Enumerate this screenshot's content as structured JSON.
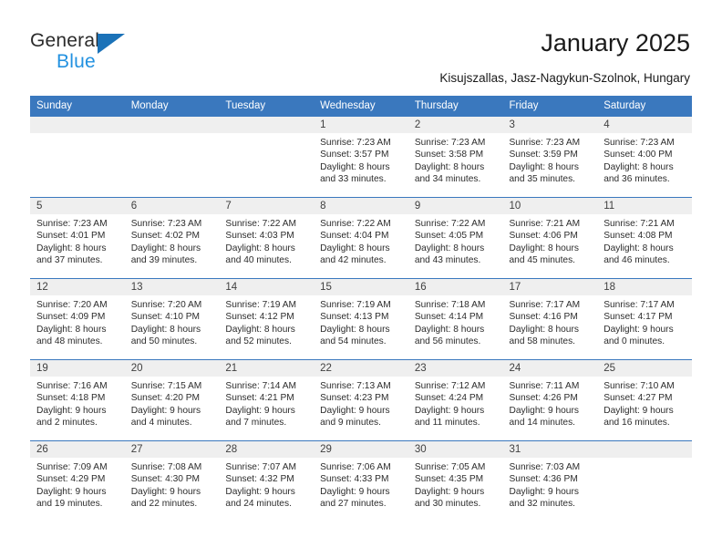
{
  "brand": {
    "name_top": "General",
    "name_bottom": "Blue",
    "accent_color": "#1b72b8",
    "accent_color_light": "#2291e0"
  },
  "header": {
    "title": "January 2025",
    "subtitle": "Kisujszallas, Jasz-Nagykun-Szolnok, Hungary"
  },
  "theme": {
    "header_row_bg": "#3a78be",
    "header_row_text": "#ffffff",
    "daynum_bg": "#efefef",
    "cell_bg": "#ffffff"
  },
  "calendar": {
    "weekday_headers": [
      "Sunday",
      "Monday",
      "Tuesday",
      "Wednesday",
      "Thursday",
      "Friday",
      "Saturday"
    ],
    "weeks": [
      [
        {
          "day": "",
          "empty": true
        },
        {
          "day": "",
          "empty": true
        },
        {
          "day": "",
          "empty": true
        },
        {
          "day": "1",
          "sunrise": "Sunrise: 7:23 AM",
          "sunset": "Sunset: 3:57 PM",
          "daylight1": "Daylight: 8 hours",
          "daylight2": "and 33 minutes."
        },
        {
          "day": "2",
          "sunrise": "Sunrise: 7:23 AM",
          "sunset": "Sunset: 3:58 PM",
          "daylight1": "Daylight: 8 hours",
          "daylight2": "and 34 minutes."
        },
        {
          "day": "3",
          "sunrise": "Sunrise: 7:23 AM",
          "sunset": "Sunset: 3:59 PM",
          "daylight1": "Daylight: 8 hours",
          "daylight2": "and 35 minutes."
        },
        {
          "day": "4",
          "sunrise": "Sunrise: 7:23 AM",
          "sunset": "Sunset: 4:00 PM",
          "daylight1": "Daylight: 8 hours",
          "daylight2": "and 36 minutes."
        }
      ],
      [
        {
          "day": "5",
          "sunrise": "Sunrise: 7:23 AM",
          "sunset": "Sunset: 4:01 PM",
          "daylight1": "Daylight: 8 hours",
          "daylight2": "and 37 minutes."
        },
        {
          "day": "6",
          "sunrise": "Sunrise: 7:23 AM",
          "sunset": "Sunset: 4:02 PM",
          "daylight1": "Daylight: 8 hours",
          "daylight2": "and 39 minutes."
        },
        {
          "day": "7",
          "sunrise": "Sunrise: 7:22 AM",
          "sunset": "Sunset: 4:03 PM",
          "daylight1": "Daylight: 8 hours",
          "daylight2": "and 40 minutes."
        },
        {
          "day": "8",
          "sunrise": "Sunrise: 7:22 AM",
          "sunset": "Sunset: 4:04 PM",
          "daylight1": "Daylight: 8 hours",
          "daylight2": "and 42 minutes."
        },
        {
          "day": "9",
          "sunrise": "Sunrise: 7:22 AM",
          "sunset": "Sunset: 4:05 PM",
          "daylight1": "Daylight: 8 hours",
          "daylight2": "and 43 minutes."
        },
        {
          "day": "10",
          "sunrise": "Sunrise: 7:21 AM",
          "sunset": "Sunset: 4:06 PM",
          "daylight1": "Daylight: 8 hours",
          "daylight2": "and 45 minutes."
        },
        {
          "day": "11",
          "sunrise": "Sunrise: 7:21 AM",
          "sunset": "Sunset: 4:08 PM",
          "daylight1": "Daylight: 8 hours",
          "daylight2": "and 46 minutes."
        }
      ],
      [
        {
          "day": "12",
          "sunrise": "Sunrise: 7:20 AM",
          "sunset": "Sunset: 4:09 PM",
          "daylight1": "Daylight: 8 hours",
          "daylight2": "and 48 minutes."
        },
        {
          "day": "13",
          "sunrise": "Sunrise: 7:20 AM",
          "sunset": "Sunset: 4:10 PM",
          "daylight1": "Daylight: 8 hours",
          "daylight2": "and 50 minutes."
        },
        {
          "day": "14",
          "sunrise": "Sunrise: 7:19 AM",
          "sunset": "Sunset: 4:12 PM",
          "daylight1": "Daylight: 8 hours",
          "daylight2": "and 52 minutes."
        },
        {
          "day": "15",
          "sunrise": "Sunrise: 7:19 AM",
          "sunset": "Sunset: 4:13 PM",
          "daylight1": "Daylight: 8 hours",
          "daylight2": "and 54 minutes."
        },
        {
          "day": "16",
          "sunrise": "Sunrise: 7:18 AM",
          "sunset": "Sunset: 4:14 PM",
          "daylight1": "Daylight: 8 hours",
          "daylight2": "and 56 minutes."
        },
        {
          "day": "17",
          "sunrise": "Sunrise: 7:17 AM",
          "sunset": "Sunset: 4:16 PM",
          "daylight1": "Daylight: 8 hours",
          "daylight2": "and 58 minutes."
        },
        {
          "day": "18",
          "sunrise": "Sunrise: 7:17 AM",
          "sunset": "Sunset: 4:17 PM",
          "daylight1": "Daylight: 9 hours",
          "daylight2": "and 0 minutes."
        }
      ],
      [
        {
          "day": "19",
          "sunrise": "Sunrise: 7:16 AM",
          "sunset": "Sunset: 4:18 PM",
          "daylight1": "Daylight: 9 hours",
          "daylight2": "and 2 minutes."
        },
        {
          "day": "20",
          "sunrise": "Sunrise: 7:15 AM",
          "sunset": "Sunset: 4:20 PM",
          "daylight1": "Daylight: 9 hours",
          "daylight2": "and 4 minutes."
        },
        {
          "day": "21",
          "sunrise": "Sunrise: 7:14 AM",
          "sunset": "Sunset: 4:21 PM",
          "daylight1": "Daylight: 9 hours",
          "daylight2": "and 7 minutes."
        },
        {
          "day": "22",
          "sunrise": "Sunrise: 7:13 AM",
          "sunset": "Sunset: 4:23 PM",
          "daylight1": "Daylight: 9 hours",
          "daylight2": "and 9 minutes."
        },
        {
          "day": "23",
          "sunrise": "Sunrise: 7:12 AM",
          "sunset": "Sunset: 4:24 PM",
          "daylight1": "Daylight: 9 hours",
          "daylight2": "and 11 minutes."
        },
        {
          "day": "24",
          "sunrise": "Sunrise: 7:11 AM",
          "sunset": "Sunset: 4:26 PM",
          "daylight1": "Daylight: 9 hours",
          "daylight2": "and 14 minutes."
        },
        {
          "day": "25",
          "sunrise": "Sunrise: 7:10 AM",
          "sunset": "Sunset: 4:27 PM",
          "daylight1": "Daylight: 9 hours",
          "daylight2": "and 16 minutes."
        }
      ],
      [
        {
          "day": "26",
          "sunrise": "Sunrise: 7:09 AM",
          "sunset": "Sunset: 4:29 PM",
          "daylight1": "Daylight: 9 hours",
          "daylight2": "and 19 minutes."
        },
        {
          "day": "27",
          "sunrise": "Sunrise: 7:08 AM",
          "sunset": "Sunset: 4:30 PM",
          "daylight1": "Daylight: 9 hours",
          "daylight2": "and 22 minutes."
        },
        {
          "day": "28",
          "sunrise": "Sunrise: 7:07 AM",
          "sunset": "Sunset: 4:32 PM",
          "daylight1": "Daylight: 9 hours",
          "daylight2": "and 24 minutes."
        },
        {
          "day": "29",
          "sunrise": "Sunrise: 7:06 AM",
          "sunset": "Sunset: 4:33 PM",
          "daylight1": "Daylight: 9 hours",
          "daylight2": "and 27 minutes."
        },
        {
          "day": "30",
          "sunrise": "Sunrise: 7:05 AM",
          "sunset": "Sunset: 4:35 PM",
          "daylight1": "Daylight: 9 hours",
          "daylight2": "and 30 minutes."
        },
        {
          "day": "31",
          "sunrise": "Sunrise: 7:03 AM",
          "sunset": "Sunset: 4:36 PM",
          "daylight1": "Daylight: 9 hours",
          "daylight2": "and 32 minutes."
        },
        {
          "day": "",
          "empty": true
        }
      ]
    ]
  }
}
